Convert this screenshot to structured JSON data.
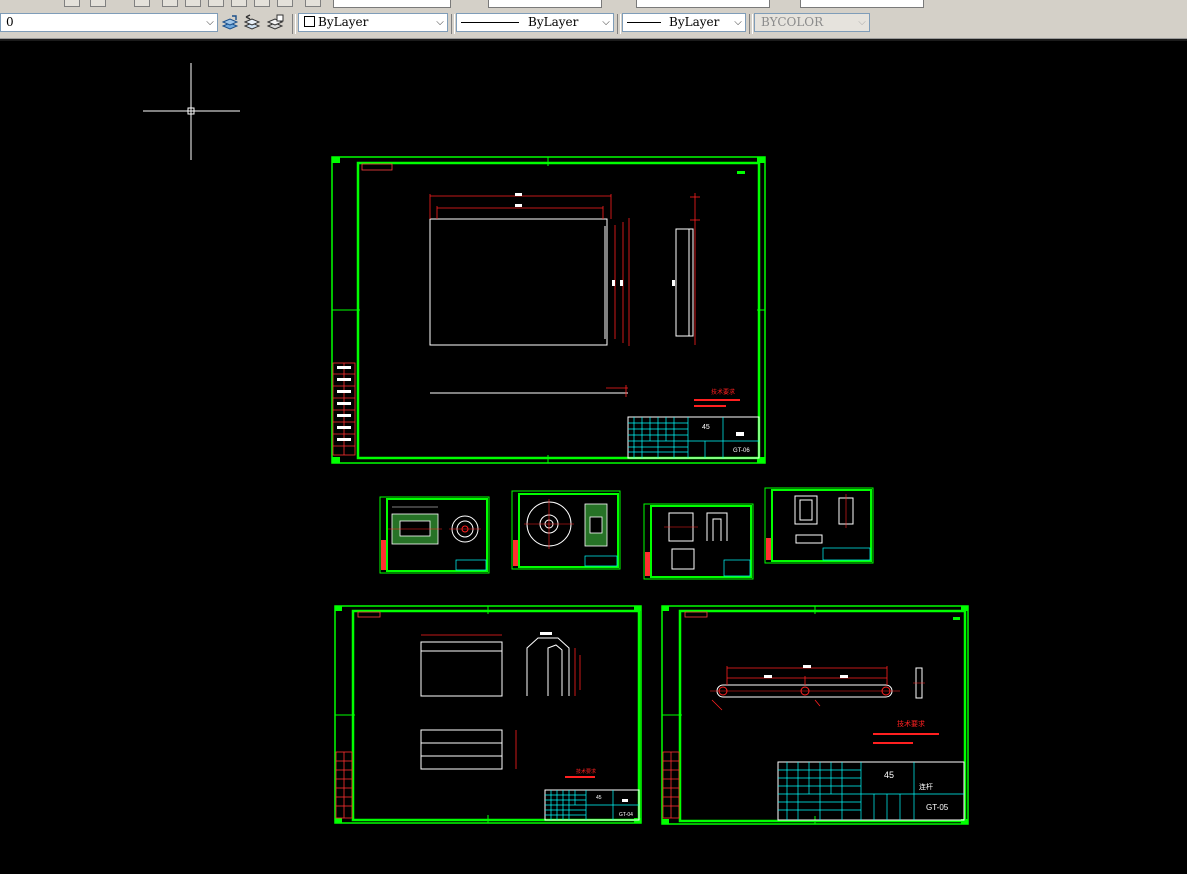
{
  "properties_toolbar": {
    "layer_value": "0",
    "color_value": "ByLayer",
    "linetype_value": "ByLayer",
    "lineweight_value": "ByLayer",
    "plotstyle_value": "BYCOLOR"
  },
  "drawing": {
    "large_sheet_top": {
      "material": "45",
      "drawing_number": "GT-06",
      "tech_title": "技术要求"
    },
    "large_sheet_bottom_left": {
      "material": "45",
      "drawing_number": "GT-04",
      "tech_title": "技术要求"
    },
    "large_sheet_bottom_right": {
      "material": "45",
      "drawing_number": "GT-05",
      "part_name": "连杆",
      "tech_title": "技术要求"
    }
  },
  "colors": {
    "frame": "#00ff00",
    "geometry": "#ffffff",
    "dimension": "#ff0000",
    "titleblock": "#00ffff",
    "crosshair": "#ffffff"
  }
}
